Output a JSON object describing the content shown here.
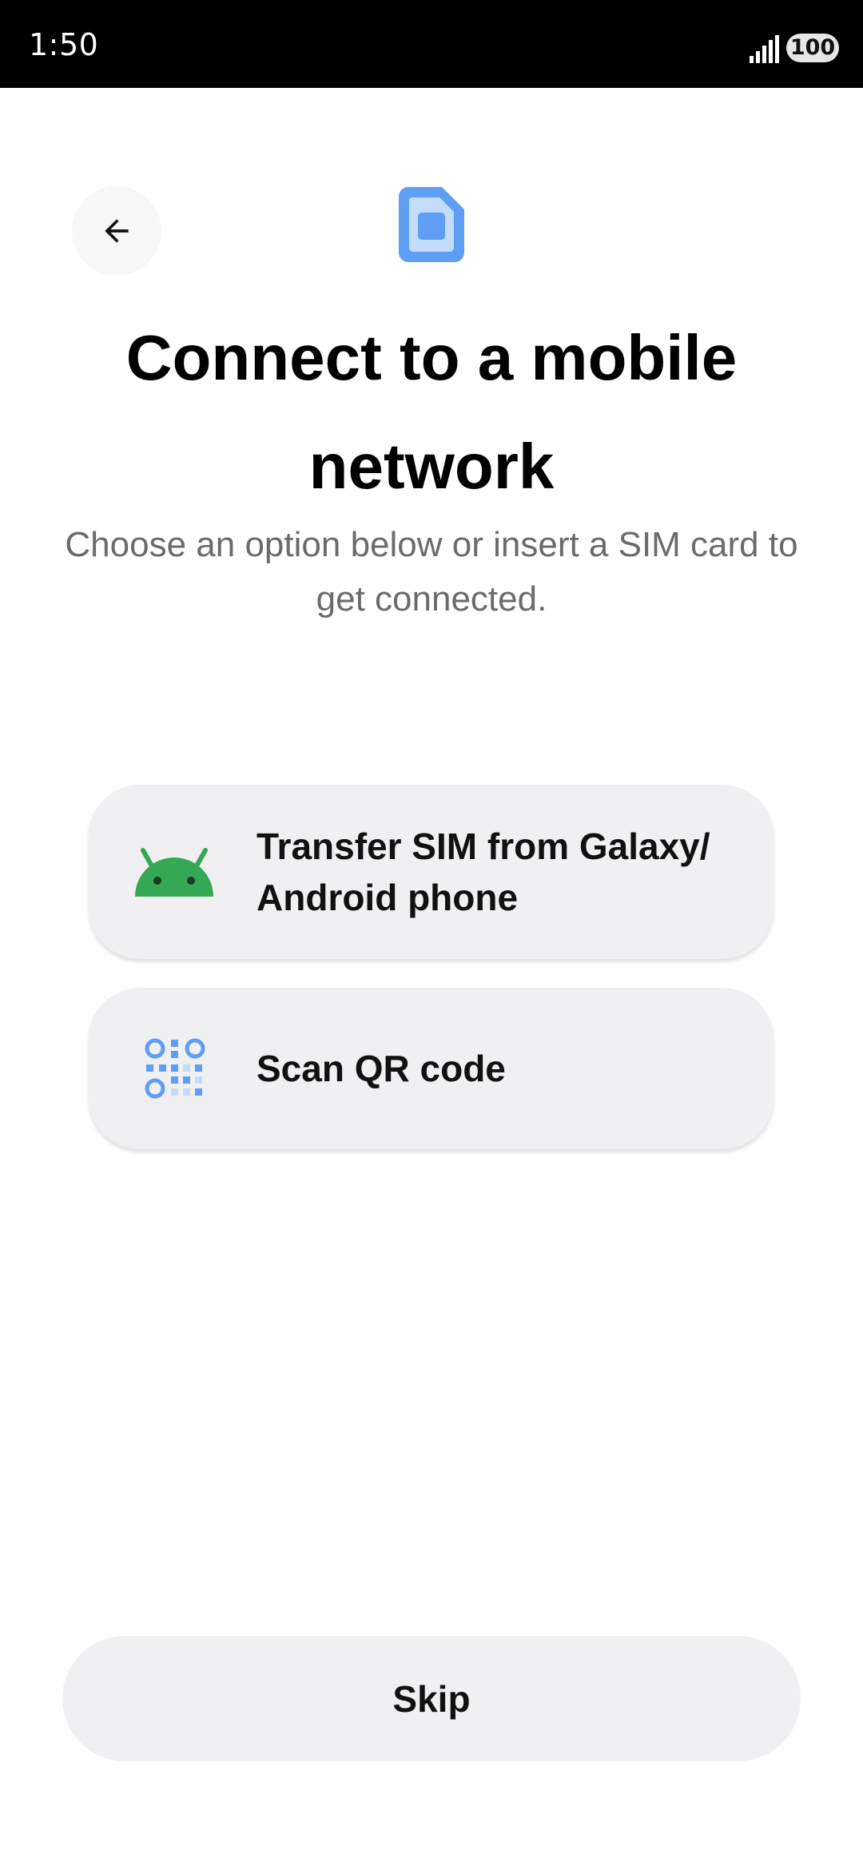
{
  "status_bar": {
    "time": "1:50",
    "battery": "100"
  },
  "header": {
    "title": "Connect to a mobile network",
    "subtitle": "Choose an option below or insert a SIM card to get connected."
  },
  "options": [
    {
      "label": "Transfer SIM from Galaxy/ Android phone",
      "icon": "android-icon"
    },
    {
      "label": "Scan QR code",
      "icon": "qr-code-icon"
    }
  ],
  "footer": {
    "skip_label": "Skip"
  },
  "colors": {
    "accent_blue": "#5e9ff5",
    "android_green": "#34a853",
    "card_bg": "#f0f0f2"
  }
}
